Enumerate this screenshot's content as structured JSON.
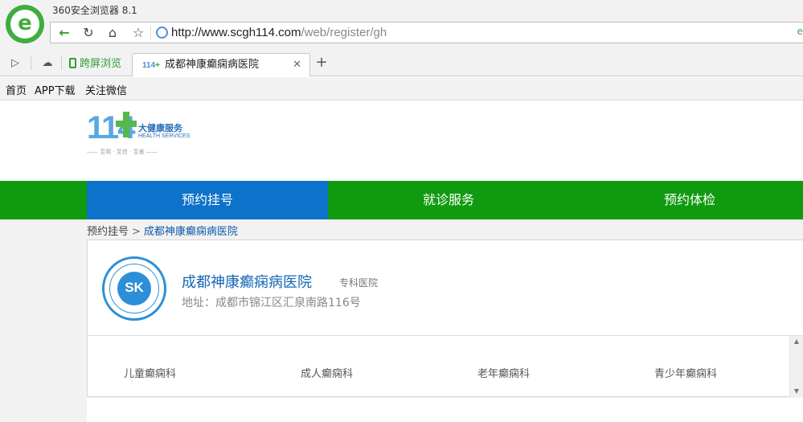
{
  "browser": {
    "title": "360安全浏览器 8.1",
    "url_host": "http://www.scgh114.com",
    "url_path": "/web/register/gh",
    "url_right_glyph": "e"
  },
  "tabs": {
    "split_label": "跨屏浏览",
    "active_label": "成都神康癫痫病医院",
    "favicon_text": "114",
    "favicon_plus": "+"
  },
  "bookmarks": [
    "首页",
    "APP下载",
    "关注微信"
  ],
  "brand": {
    "number": "114",
    "cn": "大健康服务",
    "en": "HEALTH SERVICES",
    "motto": "—— 至简 · 至信 · 至善 ——",
    "colors": {
      "blue": "#5aa7e0",
      "green": "#55b84b"
    }
  },
  "nav": {
    "items": [
      "预约挂号",
      "就诊服务",
      "预约体检"
    ],
    "active_index": 0,
    "colors": {
      "bar": "#109a10",
      "active": "#0d72c9"
    }
  },
  "breadcrumb": {
    "root": "预约挂号",
    "separator": ">",
    "current": "成都神康癫痫病医院"
  },
  "hospital": {
    "seal_text": "SK",
    "name": "成都神康癫痫病医院",
    "type": "专科医院",
    "address": "地址：成都市锦江区汇泉南路116号"
  },
  "departments": [
    "儿童癫痫科",
    "成人癫痫科",
    "老年癫痫科",
    "青少年癫痫科"
  ]
}
